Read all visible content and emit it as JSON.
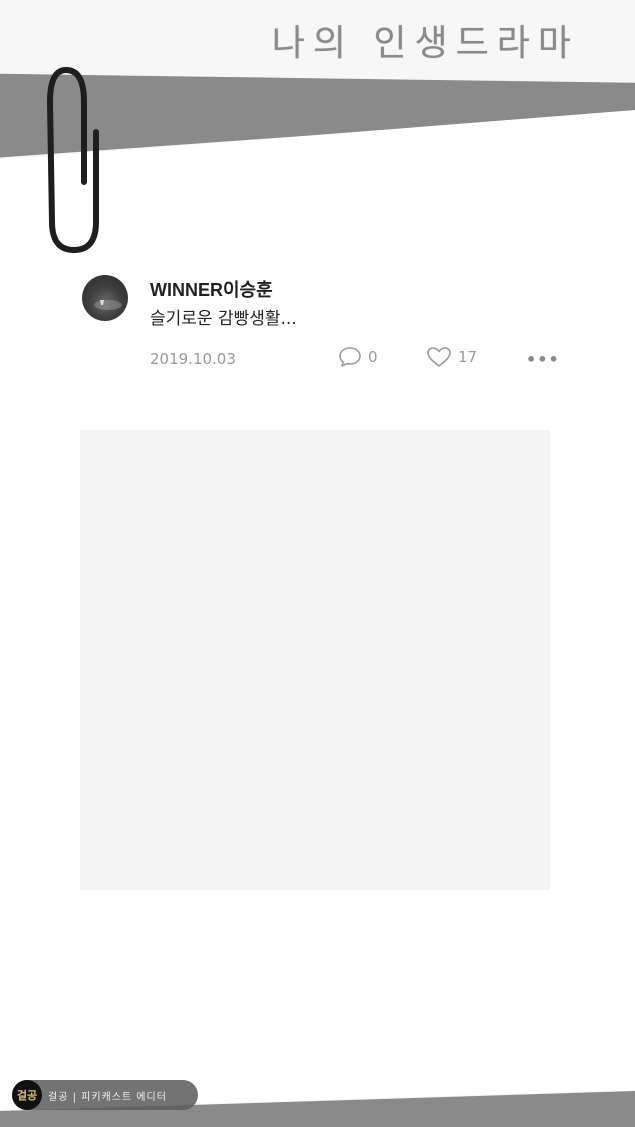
{
  "header": {
    "title": "나의 인생드라마"
  },
  "post": {
    "author": "WINNER이승훈",
    "text": "슬기로운 감빵생활...",
    "date": "2019.10.03",
    "comments": "0",
    "likes": "17",
    "more_label": "•••"
  },
  "watermark": {
    "logo": "걸공",
    "text": "걸공 | 피키캐스트 에디터"
  },
  "icons": [
    "paperclip-icon",
    "comment-icon",
    "heart-icon",
    "more-icon"
  ]
}
